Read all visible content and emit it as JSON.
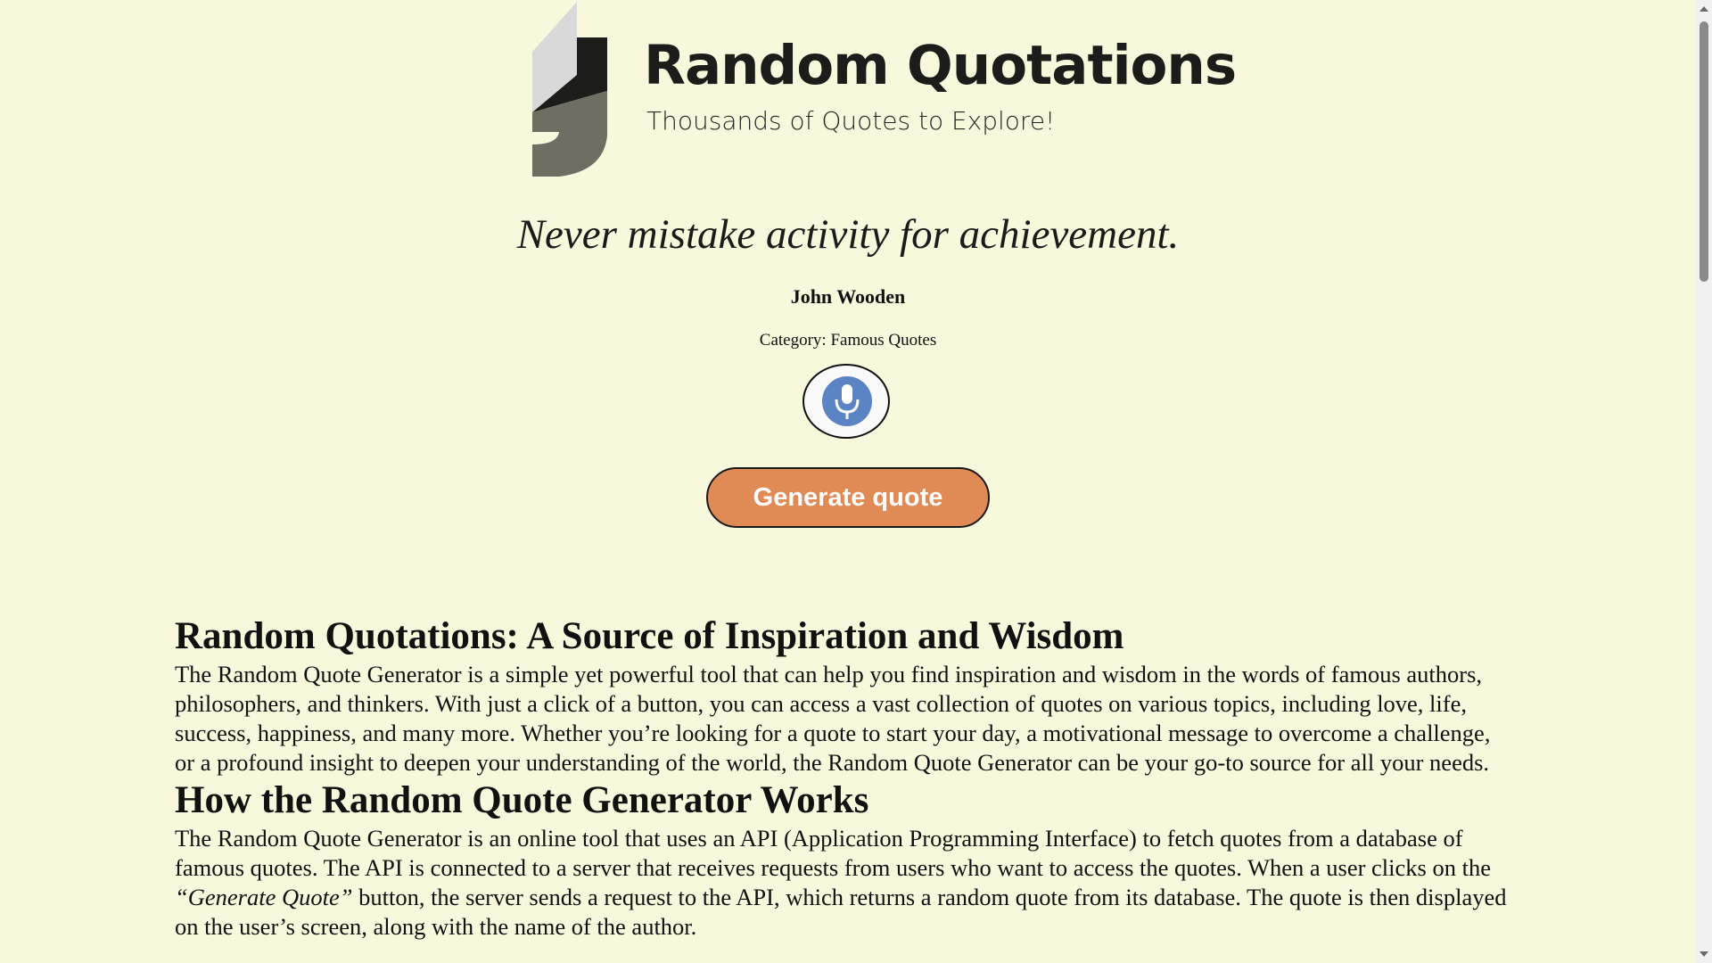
{
  "header": {
    "title": "Random Quotations",
    "tagline": "Thousands of Quotes to Explore!",
    "logo_icon": "quote-mark-logo-icon"
  },
  "quote": {
    "text": "Never mistake activity for achievement.",
    "author": "John Wooden",
    "category_label": "Category:",
    "category_value": "Famous Quotes",
    "mic_icon": "microphone-icon"
  },
  "actions": {
    "generate_label": "Generate quote"
  },
  "article": {
    "section1_heading": "Random Quotations: A Source of Inspiration and Wisdom",
    "section1_body": "The Random Quote Generator is a simple yet powerful tool that can help you find inspiration and wisdom in the words of famous authors, philosophers, and thinkers. With just a click of a button, you can access a vast collection of quotes on various topics, including love, life, success, happiness, and many more. Whether you’re looking for a quote to start your day, a motivational message to overcome a challenge, or a profound insight to deepen your understanding of the world, the Random Quote Generator can be your go-to source for all your needs.",
    "section2_heading": "How the Random Quote Generator Works",
    "section2_body_part1": "The Random Quote Generator is an online tool that uses an API (Application Programming Interface) to fetch quotes from a database of famous quotes. The API is connected to a server that receives requests from users who want to access the quotes. When a user clicks on the ",
    "section2_body_emphasis": "“Generate Quote”",
    "section2_body_part2": " button, the server sends a request to the API, which returns a random quote from its database. The quote is then displayed on the user’s screen, along with the name of the author."
  },
  "colors": {
    "background": "#f8f8dc",
    "button": "#e08a55",
    "mic": "#5b84c4"
  }
}
